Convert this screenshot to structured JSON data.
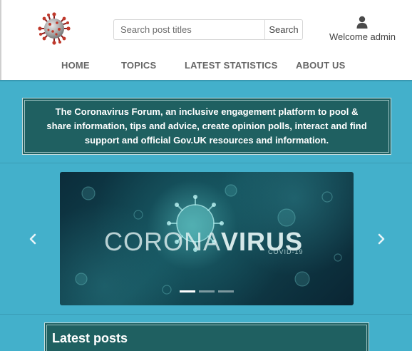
{
  "header": {
    "logo_icon": "coronavirus-logo-icon",
    "search": {
      "placeholder": "Search post titles",
      "value": "",
      "button_label": "Search"
    },
    "user": {
      "icon": "user-icon",
      "welcome_text": "Welcome admin"
    }
  },
  "nav": {
    "items": [
      {
        "label": "HOME"
      },
      {
        "label": "TOPICS"
      },
      {
        "label": "LATEST STATISTICS"
      },
      {
        "label": "ABOUT US"
      }
    ]
  },
  "banner": {
    "text": "The Coronavirus Forum, an inclusive engagement platform to pool & share information, tips and advice, create opinion polls, interact and find support and official Gov.UK resources and information."
  },
  "carousel": {
    "slide_title_light": "CORONA",
    "slide_title_bold": "VIRUS",
    "slide_subtitle": "COVID-19",
    "indicator_count": 3,
    "active_index": 0,
    "prev_icon": "chevron-left-icon",
    "next_icon": "chevron-right-icon"
  },
  "latest_posts": {
    "title": "Latest posts"
  },
  "colors": {
    "teal_background": "#43b0cb",
    "banner_background": "#1f6061",
    "nav_text": "#666666"
  }
}
